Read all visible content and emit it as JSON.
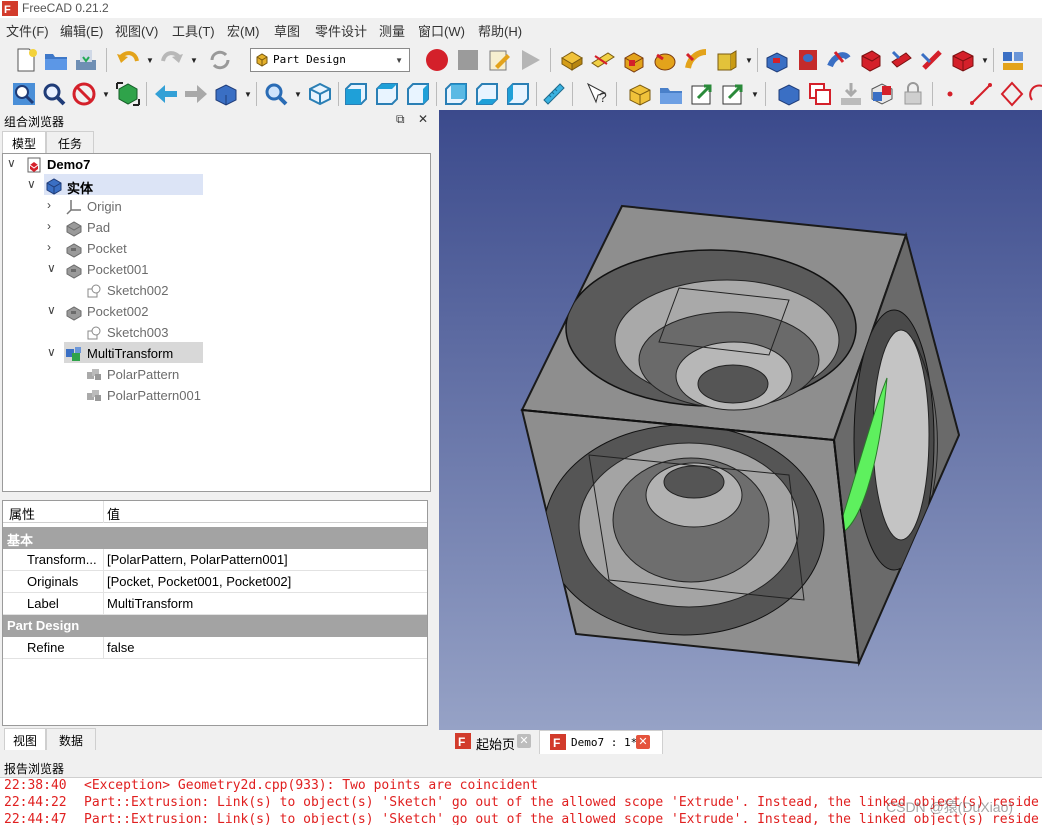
{
  "window": {
    "title": "FreeCAD 0.21.2"
  },
  "menu": [
    "文件(F)",
    "编辑(E)",
    "视图(V)",
    "工具(T)",
    "宏(M)",
    "草图",
    "零件设计",
    "测量",
    "窗口(W)",
    "帮助(H)"
  ],
  "toolbar": {
    "workbench": "Part Design"
  },
  "combo": {
    "title": "组合浏览器",
    "float_glyph": "⧉",
    "close_glyph": "✕",
    "tabs": [
      "模型",
      "任务"
    ],
    "tree": [
      {
        "label": "Demo7",
        "icon": "document-icon",
        "expanded": true
      },
      {
        "label": "实体",
        "icon": "body-icon",
        "expanded": true
      },
      {
        "label": "Origin",
        "icon": "origin-icon",
        "expanded": false
      },
      {
        "label": "Pad",
        "icon": "pad-icon",
        "expanded": false
      },
      {
        "label": "Pocket",
        "icon": "pocket-icon",
        "expanded": false
      },
      {
        "label": "Pocket001",
        "icon": "pocket-icon",
        "expanded": true
      },
      {
        "label": "Sketch002",
        "icon": "sketch-icon"
      },
      {
        "label": "Pocket002",
        "icon": "pocket-icon",
        "expanded": true
      },
      {
        "label": "Sketch003",
        "icon": "sketch-icon"
      },
      {
        "label": "MultiTransform",
        "icon": "multitransform-icon",
        "expanded": true
      },
      {
        "label": "PolarPattern",
        "icon": "polar-pattern-icon"
      },
      {
        "label": "PolarPattern001",
        "icon": "polar-pattern-icon"
      }
    ],
    "properties": {
      "header": {
        "property": "属性",
        "value": "值"
      },
      "groups": [
        {
          "name": "基本",
          "rows": [
            {
              "key": "Transform...",
              "value": "[PolarPattern, PolarPattern001]"
            },
            {
              "key": "Originals",
              "value": "[Pocket, Pocket001, Pocket002]"
            },
            {
              "key": "Label",
              "value": "MultiTransform"
            }
          ]
        },
        {
          "name": "Part Design",
          "rows": [
            {
              "key": "Refine",
              "value": "false"
            }
          ]
        }
      ]
    },
    "bottom_tabs": [
      "视图",
      "数据"
    ]
  },
  "doc_tabs": [
    {
      "label": "起始页",
      "active": false
    },
    {
      "label": "Demo7 : 1*",
      "active": true
    }
  ],
  "report": {
    "title": "报告浏览器",
    "lines": [
      {
        "time": "22:38:40",
        "text": "<Exception> Geometry2d.cpp(933): Two points are coincident"
      },
      {
        "time": "22:44:22",
        "text": "Part::Extrusion: Link(s) to object(s) 'Sketch' go out of the allowed scope 'Extrude'. Instead, the linked object(s) reside"
      },
      {
        "time": "22:44:47",
        "text": "Part::Extrusion: Link(s) to object(s) 'Sketch' go out of the allowed scope 'Extrude'. Instead, the linked object(s) reside"
      }
    ]
  },
  "watermark": "CSDN @猿(DuXiao)",
  "colors": {
    "selection": "#dce4f6",
    "selection_grey": "#d8d8d8",
    "error_text": "#e01f1f",
    "viewport_top": "#3b4a8c",
    "viewport_bottom": "#96a2c6",
    "highlight_face": "#5ef05e"
  }
}
